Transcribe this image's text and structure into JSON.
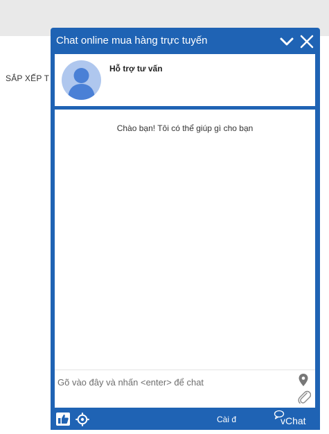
{
  "background_page": {
    "sort_label": "SẮP XẾP T"
  },
  "chat_widget": {
    "title": "Chat online mua hàng trực tuyến",
    "agent_name": "Hỗ trợ tư vấn",
    "welcome_message": "Chào bạn! Tôi có thể giúp gì cho bạn",
    "input_placeholder": "Gõ vào đây và nhấn <enter> để chat",
    "footer": {
      "settings_label": "Cài đ",
      "brand": "vChat"
    },
    "icons": {
      "header": [
        "chevron-down-icon",
        "close-icon"
      ],
      "compose": [
        "location-pin-icon",
        "paperclip-icon"
      ],
      "footer": [
        "thumbs-up-icon",
        "gear-icon",
        "vchat-logo"
      ]
    },
    "colors": {
      "primary": "#1f63b4",
      "avatar_bg": "#afc7ee",
      "avatar_figure": "#4a80d6",
      "page_topbar": "#e9e9e9"
    }
  }
}
